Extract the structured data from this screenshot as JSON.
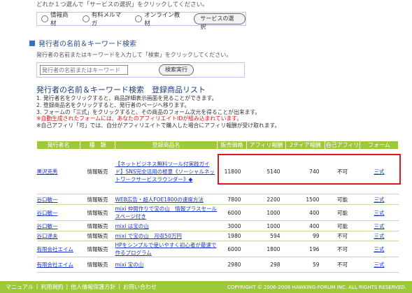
{
  "service_select": {
    "intro": "どれか１つ選んで「サービスの選択」をクリックしてください。",
    "options": [
      "情報商材",
      "有料メルマガ",
      "オンライン教材"
    ],
    "button": "サービスの選択"
  },
  "search_section": {
    "heading": "発行者の名前＆キーワード検索",
    "help": "発行者の名前またはキーワードを入力して「検索」をクリックしてください。",
    "placeholder": "発行者の名前またはキーワード",
    "button": "検索実行"
  },
  "results": {
    "title": "発行者の名前＆キーワード検索　登録商品リスト",
    "notes": [
      "1. 発行者名をクリックすると、商品詳細表示画面を見ることができます。",
      "2. 登録商品名をクリックすると、発行者のページへ移ります。",
      "3. フォームの「三式」をクリックすると、その商品のフォーム次元を得ることが出来ます。"
    ],
    "red_note": "※自動生成されたフォームには、あなたのアフィリエイトIDが組み込まれています。",
    "note_last": "※自己アフィリ「可」では、自分がアフィリエイトで購入した場合にアフィリ報酬が受け取れます。",
    "columns": [
      "発行者名",
      "種　類",
      "登録商品名",
      "販売価格",
      "アフィリ報酬",
      "2ティア報酬",
      "自己アフィリ",
      "フォーム"
    ],
    "rows": [
      {
        "publisher": "黒沢克秀",
        "type": "情報販売",
        "product": "【ネットビジネス無料ツール付実践ガイド】SNS完全活用の極意《ソーシャルネットワークサービスラウンダー》◆",
        "price": "11800",
        "affili": "5140",
        "tier2": "740",
        "self": "不可",
        "form": "三式"
      },
      {
        "publisher": "谷口敏一",
        "type": "情報販売",
        "product": "WEB広告・超人FOE1800の速度方法",
        "price": "7800",
        "affili": "2200",
        "tier2": "1500",
        "self": "可能",
        "form": "三式"
      },
      {
        "publisher": "谷口敏一",
        "type": "情報販売",
        "product": "mixi 仲間作りで宝の山　情報プラスセールスページ付き",
        "price": "6000",
        "affili": "1000",
        "tier2": "400",
        "self": "可能",
        "form": "三式"
      },
      {
        "publisher": "谷口敏一",
        "type": "情報販売",
        "product": "mixi は宝の山",
        "price": "3000",
        "affili": "1000",
        "tier2": "400",
        "self": "可能",
        "form": "三式"
      },
      {
        "publisher": "谷口達夫",
        "type": "情報販売",
        "product": "mixi で宝の山　月収50万円",
        "price": "1980",
        "affili": "594",
        "tier2": "99",
        "self": "不可",
        "form": "三式"
      },
      {
        "publisher": "有限会社エイム",
        "type": "情報販売",
        "product": "HPをシンプルで使いやすく初心者が最速で作るプログラム",
        "price": "6000",
        "affili": "1800",
        "tier2": "196",
        "self": "不可",
        "form": "三式"
      },
      {
        "publisher": "有限会社エイム",
        "type": "情報販売",
        "product": "mixi 宝の山",
        "price": "2980",
        "affili": "298",
        "tier2": "59",
        "self": "不可",
        "form": "三式"
      }
    ]
  },
  "footer": {
    "links": [
      "マニュアル",
      "利用規約",
      "他人情報保護方針",
      "お問い合わせ"
    ],
    "copyright": "COPYRIGHT © 2006-2008 HAWKING-FORUM INC. ALL RIGHTS RESERVED."
  }
}
